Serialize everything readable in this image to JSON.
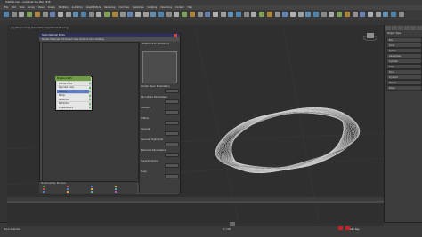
{
  "window": {
    "title": "Untitled.max - Autodesk 3ds Max 2018"
  },
  "menus": [
    "File",
    "Edit",
    "Tools",
    "Group",
    "Views",
    "Create",
    "Modifiers",
    "Animation",
    "Graph Editors",
    "Rendering",
    "Civil View",
    "Customize",
    "Scripting",
    "Interactive",
    "Content",
    "Help"
  ],
  "viewport": {
    "label": "[+] [Perspective] [User Defined] [Default Shading]"
  },
  "slate": {
    "title": "Slate Material Editor",
    "menu": "Modes  Material  Edit  Select  View  Options  Tools  Utilities",
    "node_title": "Material #25",
    "node_rows": [
      "Diffuse Color",
      "Specular Color",
      "Opacity",
      "Bump",
      "Reflection",
      "Refraction",
      "Displacement"
    ],
    "params": {
      "header": "Material #25 (Standard)",
      "swatch_label": "",
      "rows": [
        "Shader Basic Parameters",
        "Blinn Basic Parameters",
        "Ambient",
        "Diffuse",
        "Specular",
        "Specular Highlights",
        "Extended Parameters",
        "SuperSampling",
        "Maps"
      ]
    },
    "browser_header": "Material/Map Browser"
  },
  "command_panel": {
    "object_type": "Object Type",
    "rows": [
      "Box",
      "Cone",
      "Sphere",
      "GeoSphere",
      "Cylinder",
      "Tube",
      "Torus",
      "Pyramid",
      "Teapot",
      "Plane"
    ]
  },
  "timeline": {
    "frame": "0 / 100"
  },
  "status": {
    "left": "None Selected",
    "right": "Auto Key"
  },
  "colors": {
    "accent": "#5b7ec6",
    "node_head": "#6f9d45",
    "record": "#cc2222"
  }
}
